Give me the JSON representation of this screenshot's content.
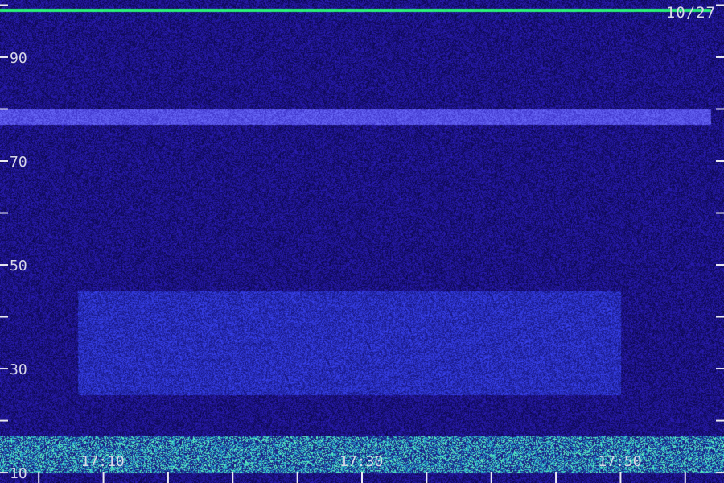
{
  "date_label": "10/27",
  "colors": {
    "background": "#0a0640",
    "noise": "#2a22c8",
    "band": "#5a4cff",
    "bright_line": "#40ff80",
    "text": "#d8d8e8"
  },
  "chart_data": {
    "type": "heatmap",
    "title": "",
    "xlabel": "",
    "ylabel": "",
    "x": {
      "unit": "time",
      "range": [
        "17:02",
        "17:58"
      ],
      "tick_labels": [
        "17:10",
        "17:30",
        "17:50"
      ],
      "tick_label_values": [
        "17:10",
        "17:30",
        "17:50"
      ],
      "minor_ticks": [
        "17:05",
        "17:10",
        "17:15",
        "17:20",
        "17:25",
        "17:30",
        "17:35",
        "17:40",
        "17:45",
        "17:50",
        "17:55"
      ]
    },
    "y": {
      "range": [
        8,
        101
      ],
      "tick_values": [
        10,
        20,
        30,
        40,
        50,
        60,
        70,
        80,
        90,
        100
      ],
      "tick_labels": [
        "10",
        "30",
        "50",
        "70",
        "90"
      ],
      "tick_label_values": [
        10,
        30,
        50,
        70,
        90
      ]
    },
    "features": [
      {
        "kind": "line",
        "y": 99,
        "x_range": [
          "17:02",
          "17:57"
        ],
        "intensity": "high"
      },
      {
        "kind": "band",
        "y_range": [
          77,
          80
        ],
        "x_range": [
          "17:02",
          "17:57"
        ],
        "intensity": "medium"
      },
      {
        "kind": "band",
        "y_range": [
          10,
          17
        ],
        "x_range": [
          "17:02",
          "17:58"
        ],
        "intensity": "high"
      },
      {
        "kind": "band",
        "y_range": [
          25,
          45
        ],
        "x_range": [
          "17:08",
          "17:50"
        ],
        "intensity": "low"
      }
    ],
    "grid": false,
    "legend": "none"
  }
}
